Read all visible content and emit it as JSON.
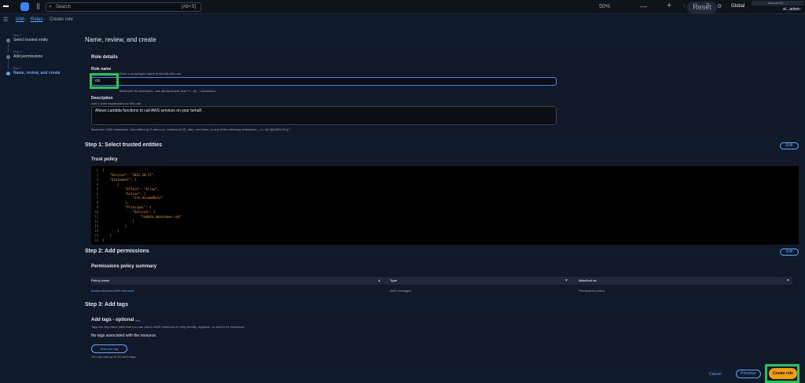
{
  "topbar": {
    "search_placeholder": "Search",
    "search_shortcut": "[Alt+S]",
    "zoom": "50%",
    "reset": "Reset",
    "region": "Global",
    "account_label": "Account ID: ...",
    "account_user": "a/...admin"
  },
  "breadcrumb": {
    "items": [
      "IAM",
      "Roles",
      "Create role"
    ]
  },
  "sidebar": {
    "steps": [
      {
        "num": "Step 1",
        "label": "Select trusted entity"
      },
      {
        "num": "Step 2",
        "label": "Add permissions"
      },
      {
        "num": "Step 3",
        "label": "Name, review, and create"
      }
    ]
  },
  "page_title": "Name, review, and create",
  "role_details": {
    "title": "Role details",
    "role_name_label": "Role name",
    "role_name_hint": "Enter a meaningful name to identify this role.",
    "role_name_value": "crc",
    "role_name_rules": "Maximum 64 characters. Use alphanumeric and '+=,.@-_' characters.",
    "description_label": "Description",
    "description_hint": "Add a short explanation for this role.",
    "description_value": "Allows Lambda functions to call AWS services on your behalf.",
    "description_rules": "Maximum 1000 characters. Use letters (A-Z and a-z), numbers (0-9), tabs, new lines, or any of the following characters: _+=,.@-/\\[\\]!#$%^&*();'\""
  },
  "step1": {
    "title": "Step 1: Select trusted entities",
    "edit": "Edit",
    "trust_policy_title": "Trust policy",
    "code_lines": [
      "{",
      "    \"Version\": \"2012-10-17\",",
      "    \"Statement\": [",
      "        {",
      "            \"Effect\": \"Allow\",",
      "            \"Action\": [",
      "                \"sts:AssumeRole\"",
      "            ],",
      "            \"Principal\": {",
      "                \"Service\": [",
      "                    \"lambda.amazonaws.com\"",
      "                ]",
      "            }",
      "        }",
      "    ]",
      "}"
    ]
  },
  "step2": {
    "title": "Step 2: Add permissions",
    "edit": "Edit",
    "panel_title": "Permissions policy summary",
    "columns": [
      "Policy name",
      "Type",
      "Attached as"
    ],
    "row": {
      "policy": "AmazonDynamoDBFullAccess",
      "type": "AWS managed",
      "attached": "Permissions policy"
    }
  },
  "step3": {
    "title": "Step 3: Add tags",
    "tags_title": "Add tags - optional",
    "info": "Info",
    "tags_hint": "Tags are key-value pairs that you can add to AWS resources to help identify, organize, or search for resources.",
    "no_tags": "No tags associated with the resource.",
    "add_tag": "Add new tag",
    "add_limit": "You can add up to 50 more tags."
  },
  "footer": {
    "cancel": "Cancel",
    "previous": "Previous",
    "create": "Create role"
  }
}
